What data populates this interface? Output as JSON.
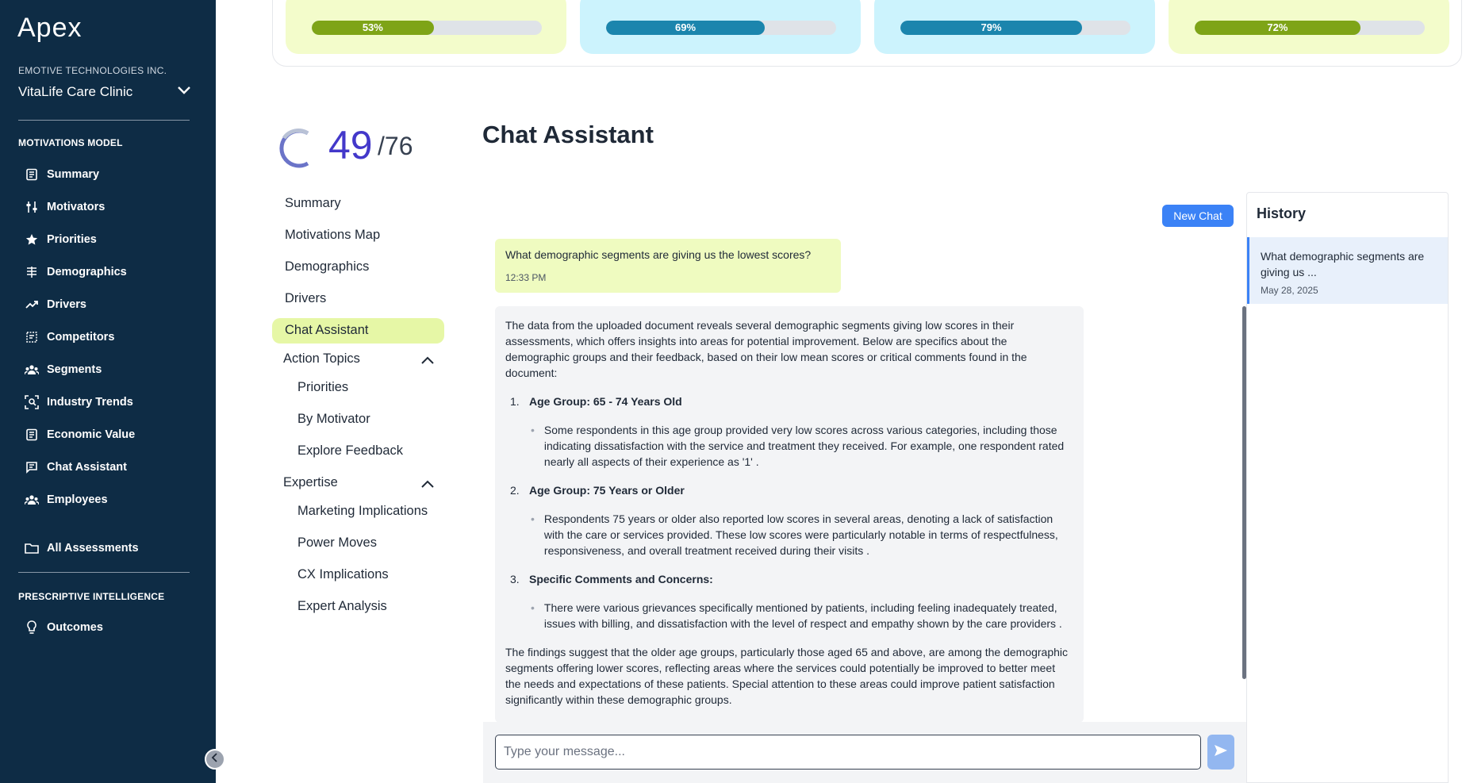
{
  "app": {
    "name": "Apex"
  },
  "sidebar": {
    "company": "EMOTIVE TECHNOLOGIES INC.",
    "clinic": "VitaLife Care Clinic",
    "section_model": "MOTIVATIONS MODEL",
    "items": [
      {
        "label": "Summary",
        "icon": "document-icon"
      },
      {
        "label": "Motivators",
        "icon": "sliders-icon"
      },
      {
        "label": "Priorities",
        "icon": "star-icon"
      },
      {
        "label": "Demographics",
        "icon": "demographics-icon"
      },
      {
        "label": "Drivers",
        "icon": "trend-up-icon"
      },
      {
        "label": "Competitors",
        "icon": "competitors-icon"
      },
      {
        "label": "Segments",
        "icon": "group-icon"
      },
      {
        "label": "Industry Trends",
        "icon": "scan-user-icon"
      },
      {
        "label": "Economic Value",
        "icon": "document-icon"
      },
      {
        "label": "Chat Assistant",
        "icon": "chat-icon"
      },
      {
        "label": "Employees",
        "icon": "group-icon"
      }
    ],
    "all_assessments": "All Assessments",
    "section_prescriptive": "PRESCRIPTIVE INTELLIGENCE",
    "outcomes": "Outcomes"
  },
  "top_cards": [
    {
      "percent": "53%",
      "value": 0.53,
      "bg": "#f3fccb",
      "fill": "#7ea417"
    },
    {
      "percent": "69%",
      "value": 0.69,
      "bg": "#ccf3fd",
      "fill": "#1b85ad"
    },
    {
      "percent": "79%",
      "value": 0.79,
      "bg": "#ccf3fd",
      "fill": "#1b85ad"
    },
    {
      "percent": "72%",
      "value": 0.72,
      "bg": "#f3fccb",
      "fill": "#7ea417"
    }
  ],
  "score": {
    "value": "49",
    "total": "/76"
  },
  "subnav": {
    "summary": "Summary",
    "motivations_map": "Motivations Map",
    "demographics": "Demographics",
    "drivers": "Drivers",
    "chat_assistant": "Chat Assistant",
    "action_topics": "Action Topics",
    "priorities": "Priorities",
    "by_motivator": "By Motivator",
    "explore_feedback": "Explore Feedback",
    "expertise": "Expertise",
    "marketing_implications": "Marketing Implications",
    "power_moves": "Power Moves",
    "cx_implications": "CX Implications",
    "expert_analysis": "Expert Analysis"
  },
  "chat": {
    "title": "Chat Assistant",
    "new_chat": "New Chat",
    "user_question": "What demographic segments are giving us the lowest scores?",
    "user_time": "12:33 PM",
    "answer_intro": "The data from the uploaded document reveals several demographic segments giving low scores in their assessments, which offers insights into areas for potential improvement. Below are specifics about the demographic groups and their feedback, based on their low mean scores or critical comments found in the document:",
    "points": [
      {
        "num": "1.",
        "title": "Age Group: 65 - 74 Years Old",
        "detail": "Some respondents in this age group provided very low scores across various categories, including those indicating dissatisfaction with the service and treatment they received. For example, one respondent rated nearly all aspects of their experience as '1' ."
      },
      {
        "num": "2.",
        "title": "Age Group: 75 Years or Older",
        "detail": "Respondents 75 years or older also reported low scores in several areas, denoting a lack of satisfaction with the care or services provided. These low scores were particularly notable in terms of respectfulness, responsiveness, and overall treatment received during their visits ."
      },
      {
        "num": "3.",
        "title": "Specific Comments and Concerns:",
        "detail": "There were various grievances specifically mentioned by patients, including feeling inadequately treated, issues with billing, and dissatisfaction with the level of respect and empathy shown by the care providers ."
      }
    ],
    "answer_conclusion": "The findings suggest that the older age groups, particularly those aged 65 and above, are among the demographic segments offering lower scores, reflecting areas where the services could potentially be improved to better meet the needs and expectations of these patients. Special attention to these areas could improve patient satisfaction significantly within these demographic groups.",
    "input_placeholder": "Type your message..."
  },
  "history": {
    "title": "History",
    "items": [
      {
        "question": "What demographic segments are giving us ...",
        "date": "May 28, 2025"
      }
    ]
  }
}
